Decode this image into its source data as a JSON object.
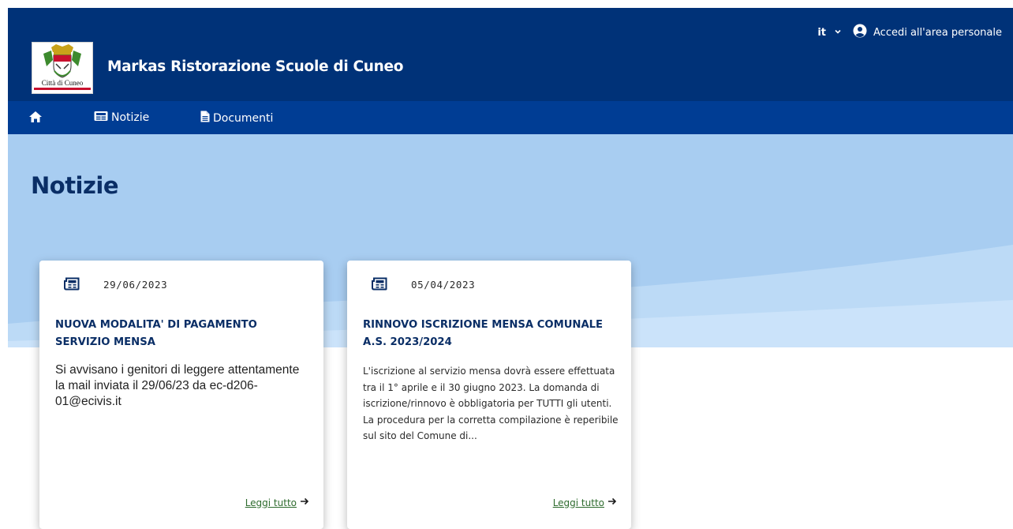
{
  "header": {
    "site_title": "Markas Ristorazione Scuole di Cuneo",
    "logo_caption": "Città di Cuneo",
    "language": "it",
    "login_label": "Accedi all'area personale",
    "color_bg": "#003278"
  },
  "nav": {
    "home_icon": "home-icon",
    "items": [
      {
        "label": "Notizie",
        "icon": "newspaper-icon"
      },
      {
        "label": "Documenti",
        "icon": "document-icon"
      }
    ],
    "color_bg": "#003d94"
  },
  "main": {
    "page_title": "Notizie",
    "hero_color": "#a8cdf1",
    "cards": [
      {
        "date": "29/06/2023",
        "title": "NUOVA MODALITA' DI PAGAMENTO SERVIZIO MENSA",
        "body": "Si avvisano i genitori di leggere attentamente la mail inviata il 29/06/23 da ec-d206-01@ecivis.it",
        "link_label": "Leggi tutto",
        "icon": "newspaper-icon"
      },
      {
        "date": "05/04/2023",
        "title": "RINNOVO ISCRIZIONE MENSA COMUNALE A.S. 2023/2024",
        "body": "L'iscrizione al servizio mensa dovrà essere effettuata tra il 1° aprile e il 30 giugno 2023. La domanda di iscrizione/rinnovo è obbligatoria per TUTTI gli utenti. La procedura per la corretta compilazione è reperibile sul sito del Comune di...",
        "link_label": "Leggi tutto",
        "icon": "newspaper-icon"
      }
    ]
  }
}
